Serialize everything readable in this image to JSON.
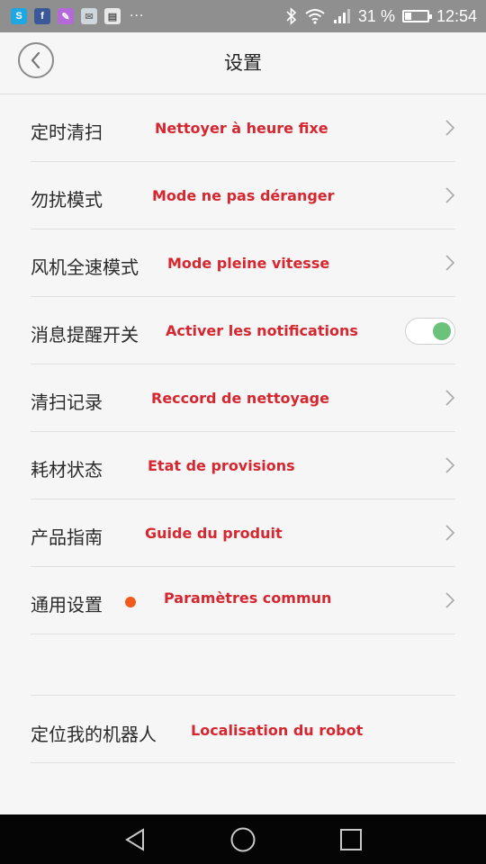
{
  "status_bar": {
    "notification_icons": [
      {
        "name": "skype-icon",
        "glyph": "S",
        "color": "#1ea7e0"
      },
      {
        "name": "facebook-icon",
        "glyph": "f",
        "color": "#3b5998"
      },
      {
        "name": "gallery-icon",
        "glyph": "✎",
        "color": "#b36ad8"
      },
      {
        "name": "mail-icon",
        "glyph": "✉",
        "color": "#cfd6dc"
      },
      {
        "name": "store-icon",
        "glyph": "▤",
        "color": "#e8e8e8"
      }
    ],
    "more": "···",
    "battery_text": "31 %",
    "battery_level": 0.31,
    "time": "12:54"
  },
  "header": {
    "title": "设置",
    "back_icon": "chevron-left-icon"
  },
  "settings": [
    {
      "label": "定时清扫",
      "note": "Nettoyer à heure fixe",
      "control": "chevron"
    },
    {
      "label": "勿扰模式",
      "note": "Mode ne pas déranger",
      "control": "chevron"
    },
    {
      "label": "风机全速模式",
      "note": "Mode pleine vitesse",
      "control": "chevron"
    },
    {
      "label": "消息提醒开关",
      "note": "Activer les notifications",
      "control": "toggle",
      "toggle_on": true
    },
    {
      "label": "清扫记录",
      "note": "Reccord de nettoyage",
      "control": "chevron"
    },
    {
      "label": "耗材状态",
      "note": "Etat de provisions",
      "control": "chevron"
    },
    {
      "label": "产品指南",
      "note": "Guide du produit",
      "control": "chevron"
    },
    {
      "label": "通用设置",
      "note": "Paramètres commun",
      "control": "chevron",
      "badge": true
    }
  ],
  "settings2": [
    {
      "label": "定位我的机器人",
      "note": "Localisation du robot"
    }
  ],
  "colors": {
    "note_red": "#d6262f",
    "toggle_green": "#6bc27a",
    "badge_orange": "#f25a1c"
  },
  "navbar": [
    "back-triangle-icon",
    "home-circle-icon",
    "recents-square-icon"
  ]
}
